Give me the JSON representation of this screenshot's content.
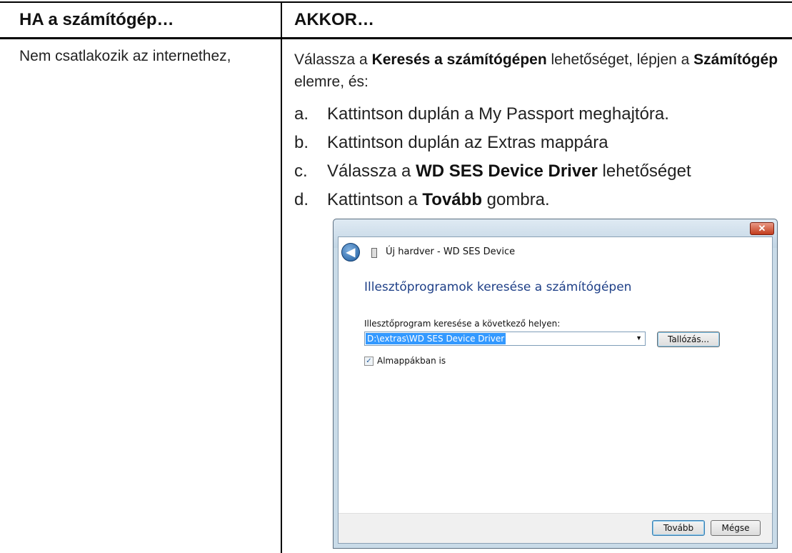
{
  "table": {
    "header_if": "HA a számítógép…",
    "header_then": "AKKOR…",
    "condition": "Nem csatlakozik az internethez,",
    "intro": {
      "part1": "Válassza a ",
      "bold1": "Keresés a számítógépen",
      "part2": " lehetőséget, lépjen a ",
      "bold2": "Számítógép",
      "part3": " elemre, és:"
    },
    "steps": [
      {
        "label": "a.",
        "text": "Kattintson duplán a My Passport meghajtóra."
      },
      {
        "label": "b.",
        "text": "Kattintson duplán az Extras mappára"
      },
      {
        "label": "c.",
        "pre": "Válassza a ",
        "bold": "WD SES Device Driver",
        "post": " lehetőséget"
      },
      {
        "label": "d.",
        "pre": "Kattintson a ",
        "bold": "Tovább",
        "post": " gombra."
      }
    ]
  },
  "dialog": {
    "close_glyph": "✕",
    "back_glyph": "◀",
    "title": "Új hardver - WD SES Device",
    "heading": "Illesztőprogramok keresése a számítógépen",
    "location_label": "Illesztőprogram keresése a következő helyen:",
    "location_value": "D:\\extras\\WD SES Device Driver",
    "combo_arrow": "▼",
    "browse_button": "Tallózás...",
    "checkbox_label": "Almappákban is",
    "checkbox_mark": "✓",
    "next_button": "Tovább",
    "cancel_button": "Mégse",
    "icons": [
      "back-arrow-icon",
      "usb-device-icon",
      "close-icon",
      "dropdown-arrow-icon",
      "checkbox-checked-icon"
    ],
    "colors": {
      "heading": "#1e3f87",
      "selection": "#3399ff",
      "close": "#c23b1c"
    }
  }
}
